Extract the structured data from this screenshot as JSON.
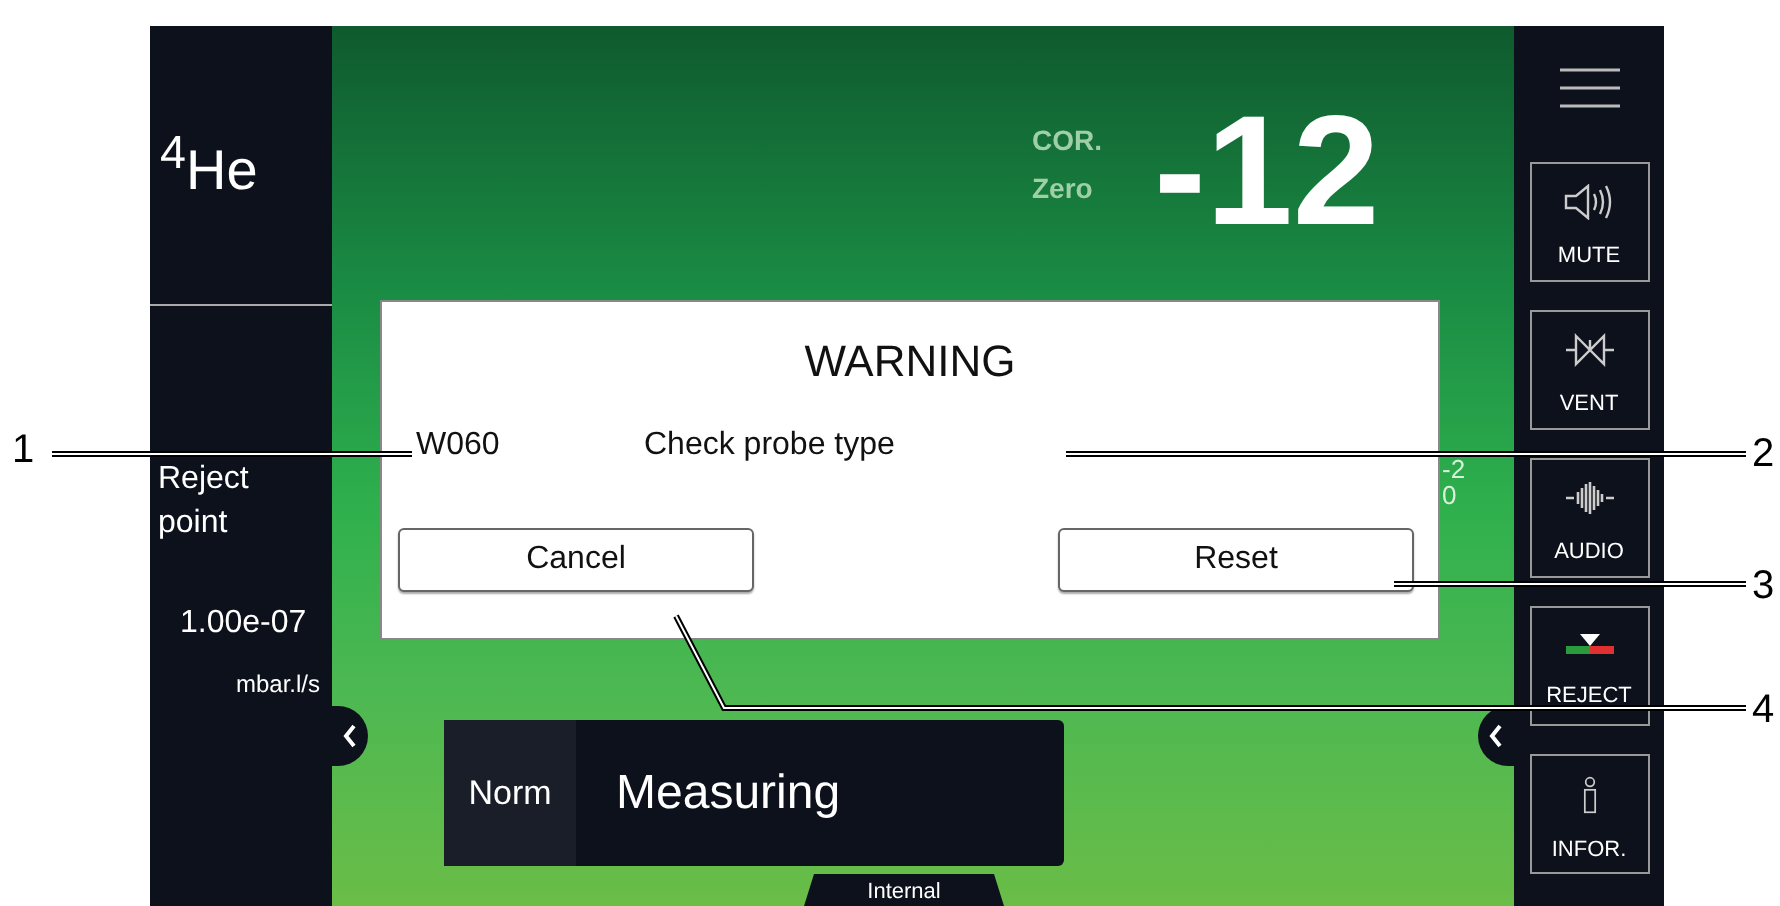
{
  "gas": "$^{4}$He",
  "reject_point": {
    "label": "Reject point",
    "value": "1.00e-07",
    "unit": "mbar.l/s"
  },
  "correction": {
    "label_1": "COR.",
    "label_2": "Zero",
    "value": "-12"
  },
  "partial_values": [
    "-2",
    "0"
  ],
  "status": {
    "mode": "Norm",
    "state": "Measuring"
  },
  "bottom_tab": "Internal",
  "side_buttons": [
    {
      "kind": "mute",
      "label": "MUTE"
    },
    {
      "kind": "vent",
      "label": "VENT"
    },
    {
      "kind": "audio",
      "label": "AUDIO"
    },
    {
      "kind": "reject",
      "label": "REJECT"
    },
    {
      "kind": "info",
      "label": "INFOR."
    }
  ],
  "dialog": {
    "title": "WARNING",
    "code": "W060",
    "message": "Check probe type",
    "buttons": [
      "Cancel",
      "Reset"
    ]
  },
  "callouts": [
    "1",
    "2",
    "3",
    "4"
  ]
}
